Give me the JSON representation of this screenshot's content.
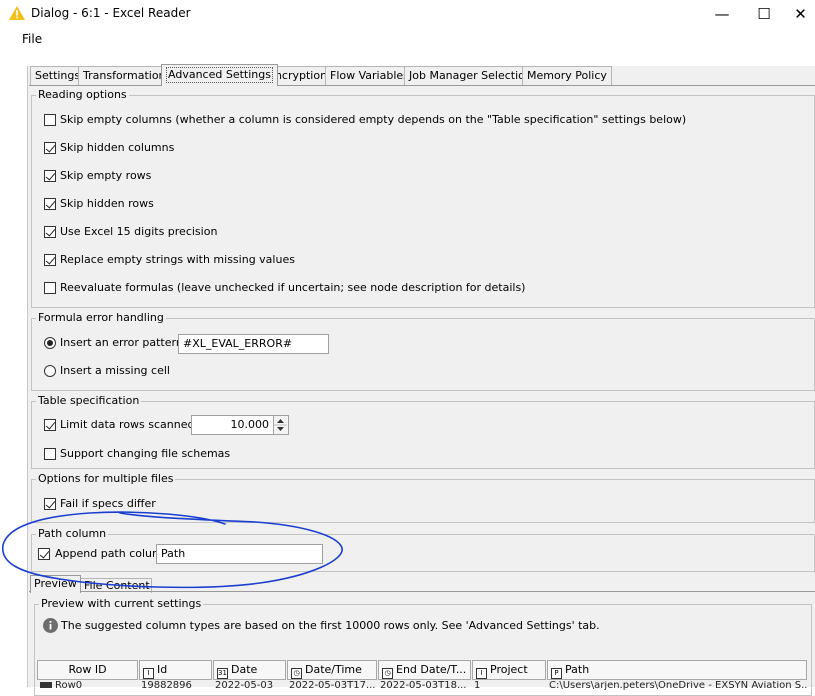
{
  "window": {
    "title": "Dialog - 6:1 - Excel Reader",
    "minimize_glyph": "—",
    "maximize_glyph": "☐",
    "close_glyph": "✕"
  },
  "menu": {
    "file": "File"
  },
  "tabs": [
    {
      "label": "Settings",
      "active": false
    },
    {
      "label": "Transformation",
      "active": false
    },
    {
      "label": "Advanced Settings",
      "active": true
    },
    {
      "label": "Encryption",
      "active": false
    },
    {
      "label": "Flow Variables",
      "active": false
    },
    {
      "label": "Job Manager Selection",
      "active": false
    },
    {
      "label": "Memory Policy",
      "active": false
    }
  ],
  "reading_options": {
    "title": "Reading options",
    "items": [
      {
        "label": "Skip empty columns (whether a column is considered empty depends on the \"Table specification\" settings below)",
        "checked": false
      },
      {
        "label": "Skip hidden columns",
        "checked": true
      },
      {
        "label": "Skip empty rows",
        "checked": true
      },
      {
        "label": "Skip hidden rows",
        "checked": true
      },
      {
        "label": "Use Excel 15 digits precision",
        "checked": true
      },
      {
        "label": "Replace empty strings with missing values",
        "checked": true
      },
      {
        "label": "Reevaluate formulas (leave unchecked if uncertain; see node description for details)",
        "checked": false
      }
    ]
  },
  "formula_error": {
    "title": "Formula error handling",
    "insert_pattern_label": "Insert an error pattern",
    "pattern_value": "#XL_EVAL_ERROR#",
    "insert_missing_label": "Insert a missing cell"
  },
  "table_spec": {
    "title": "Table specification",
    "limit_label": "Limit data rows scanned",
    "limit_value": "10.000",
    "support_label": "Support changing file schemas"
  },
  "multiple_files": {
    "title": "Options for multiple files",
    "fail_label": "Fail if specs differ"
  },
  "path_column": {
    "title": "Path column",
    "append_label": "Append path column",
    "path_value": "Path"
  },
  "preview_tabs": {
    "preview": "Preview",
    "file_content": "File Content"
  },
  "preview": {
    "title": "Preview with current settings",
    "info": "The suggested column types are based on the first 10000 rows only. See 'Advanced Settings' tab.",
    "columns": [
      {
        "label": "Row ID",
        "icon": ""
      },
      {
        "label": "Id",
        "icon": "I"
      },
      {
        "label": "Date",
        "icon": "31"
      },
      {
        "label": "Date/Time",
        "icon": "◷"
      },
      {
        "label": "End Date/T...",
        "icon": "◷"
      },
      {
        "label": "Project",
        "icon": "I"
      },
      {
        "label": "Path",
        "icon": "P"
      }
    ],
    "first_row": [
      "Row0",
      "19882896",
      "2022-05-03",
      "2022-05-03T17...",
      "2022-05-03T18...",
      "1",
      "C:\\Users\\arjen.peters\\OneDrive - EXSYN Aviation S..."
    ]
  },
  "colors": {
    "annotation": "#1a3fd0",
    "warning": "#f2c01a",
    "info_icon": "#6d6d6d"
  }
}
